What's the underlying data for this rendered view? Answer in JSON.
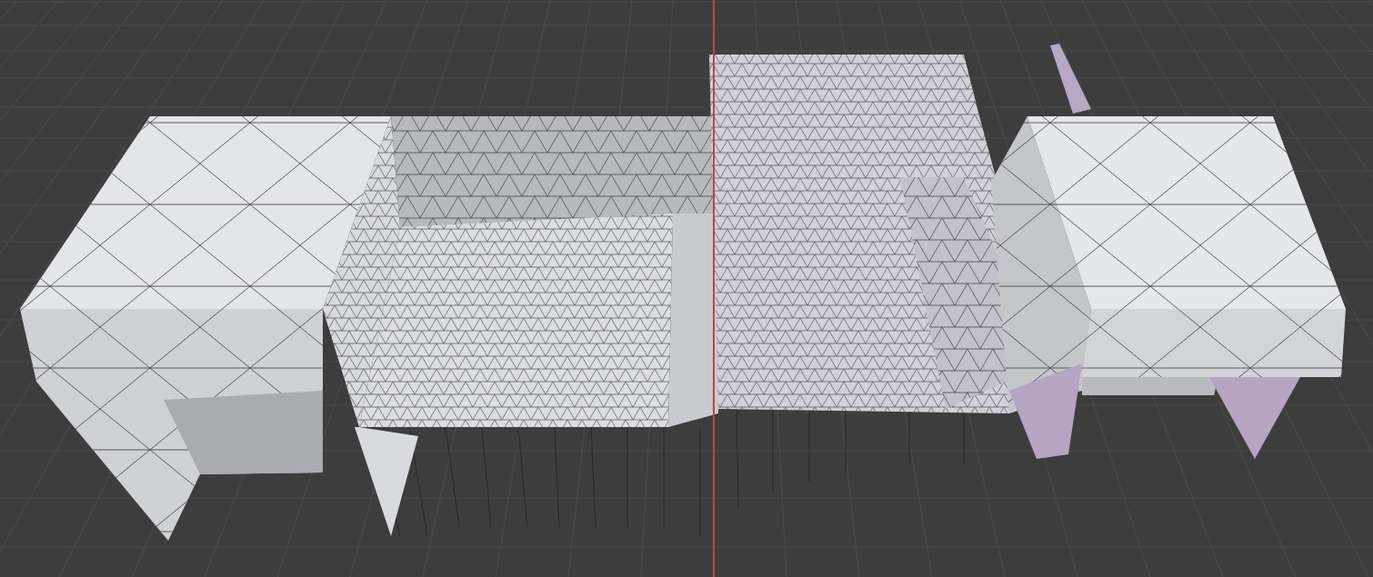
{
  "viewport": {
    "show_grid": true,
    "show_axis_line": true
  }
}
